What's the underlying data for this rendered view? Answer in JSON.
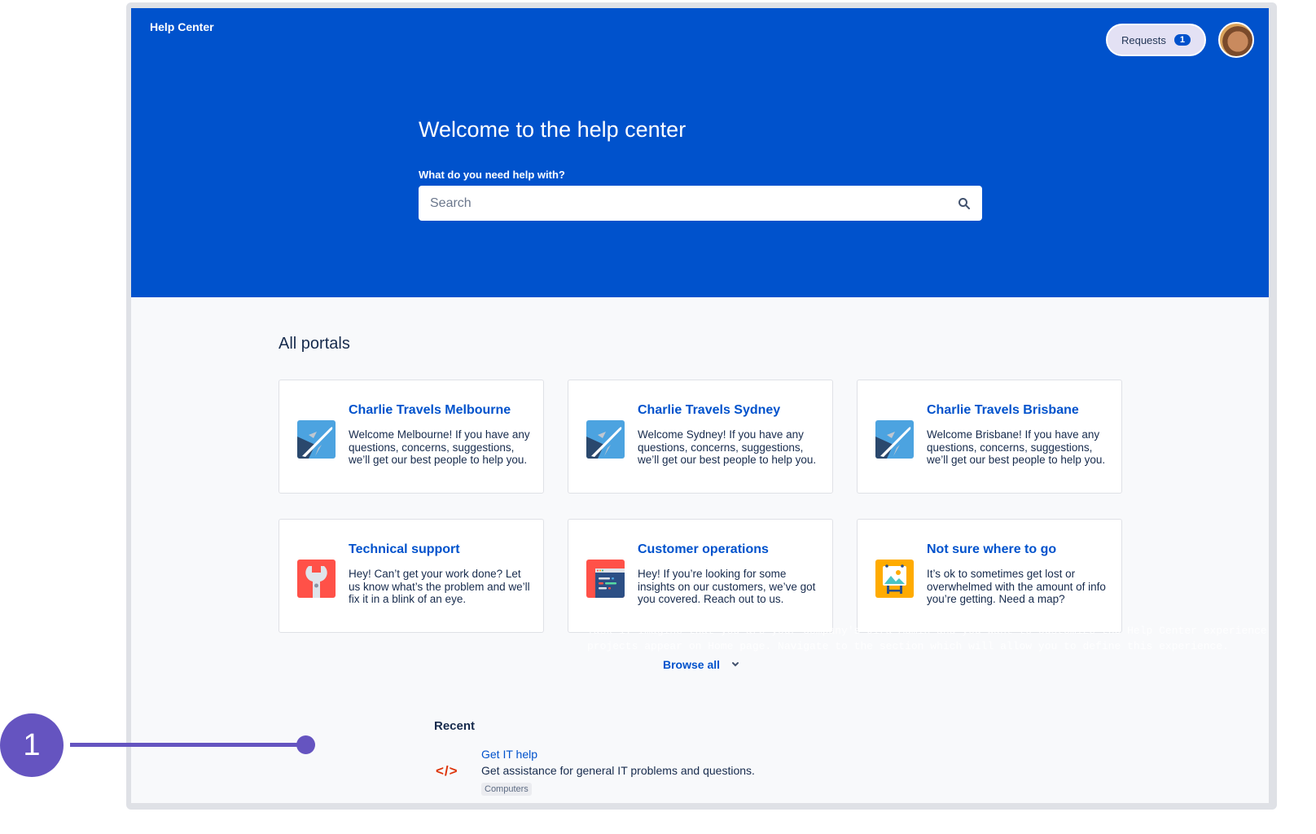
{
  "header": {
    "brand": "Help Center",
    "requests_label": "Requests",
    "requests_count": "1"
  },
  "hero": {
    "title": "Welcome to the help center",
    "search_label": "What do you need help with?",
    "search_placeholder": "Search",
    "search_value": ""
  },
  "portals": {
    "title": "All portals",
    "items": [
      {
        "title": "Charlie Travels Melbourne",
        "desc": "Welcome Melbourne! If you have any questions, concerns, suggestions, we’ll get our best people to help you.",
        "icon": "airplane-icon"
      },
      {
        "title": "Charlie Travels Sydney",
        "desc": "Welcome Sydney! If you have any questions, concerns, suggestions, we’ll get our best people to help you.",
        "icon": "airplane-icon"
      },
      {
        "title": "Charlie Travels Brisbane",
        "desc": "Welcome Brisbane! If you have any questions, concerns, suggestions, we’ll get our best people to help you.",
        "icon": "airplane-icon"
      },
      {
        "title": "Technical support",
        "desc": "Hey! Can’t get your work done? Let us know what’s the problem and we’ll fix it in a blink of an eye.",
        "icon": "wrench-icon"
      },
      {
        "title": "Customer operations",
        "desc": "Hey! If you’re looking for some insights on our customers, we’ve got you covered. Reach out to us.",
        "icon": "code-window-icon"
      },
      {
        "title": "Not sure where to go",
        "desc": "It’s ok to sometimes get lost or overwhelmed with the amount of info you’re getting. Need a map?",
        "icon": "easel-picture-icon"
      }
    ],
    "browse_all": "Browse all"
  },
  "overlay_text": {
    "line1": "Task 1: Imagine that you are your company's Jira Admin and you want to customize the Help Center experience",
    "line2": "projects appear on Home page. Navigate to the section which will allow you to define this experience."
  },
  "recent": {
    "title": "Recent",
    "items": [
      {
        "icon_text": "</>",
        "link": "Get IT help",
        "desc": "Get assistance for general IT problems and questions.",
        "tag": "Computers"
      }
    ]
  },
  "callout": {
    "number": "1"
  },
  "colors": {
    "brand": "#0052cc",
    "callout": "#6554c0",
    "background": "#f8f9fb"
  }
}
